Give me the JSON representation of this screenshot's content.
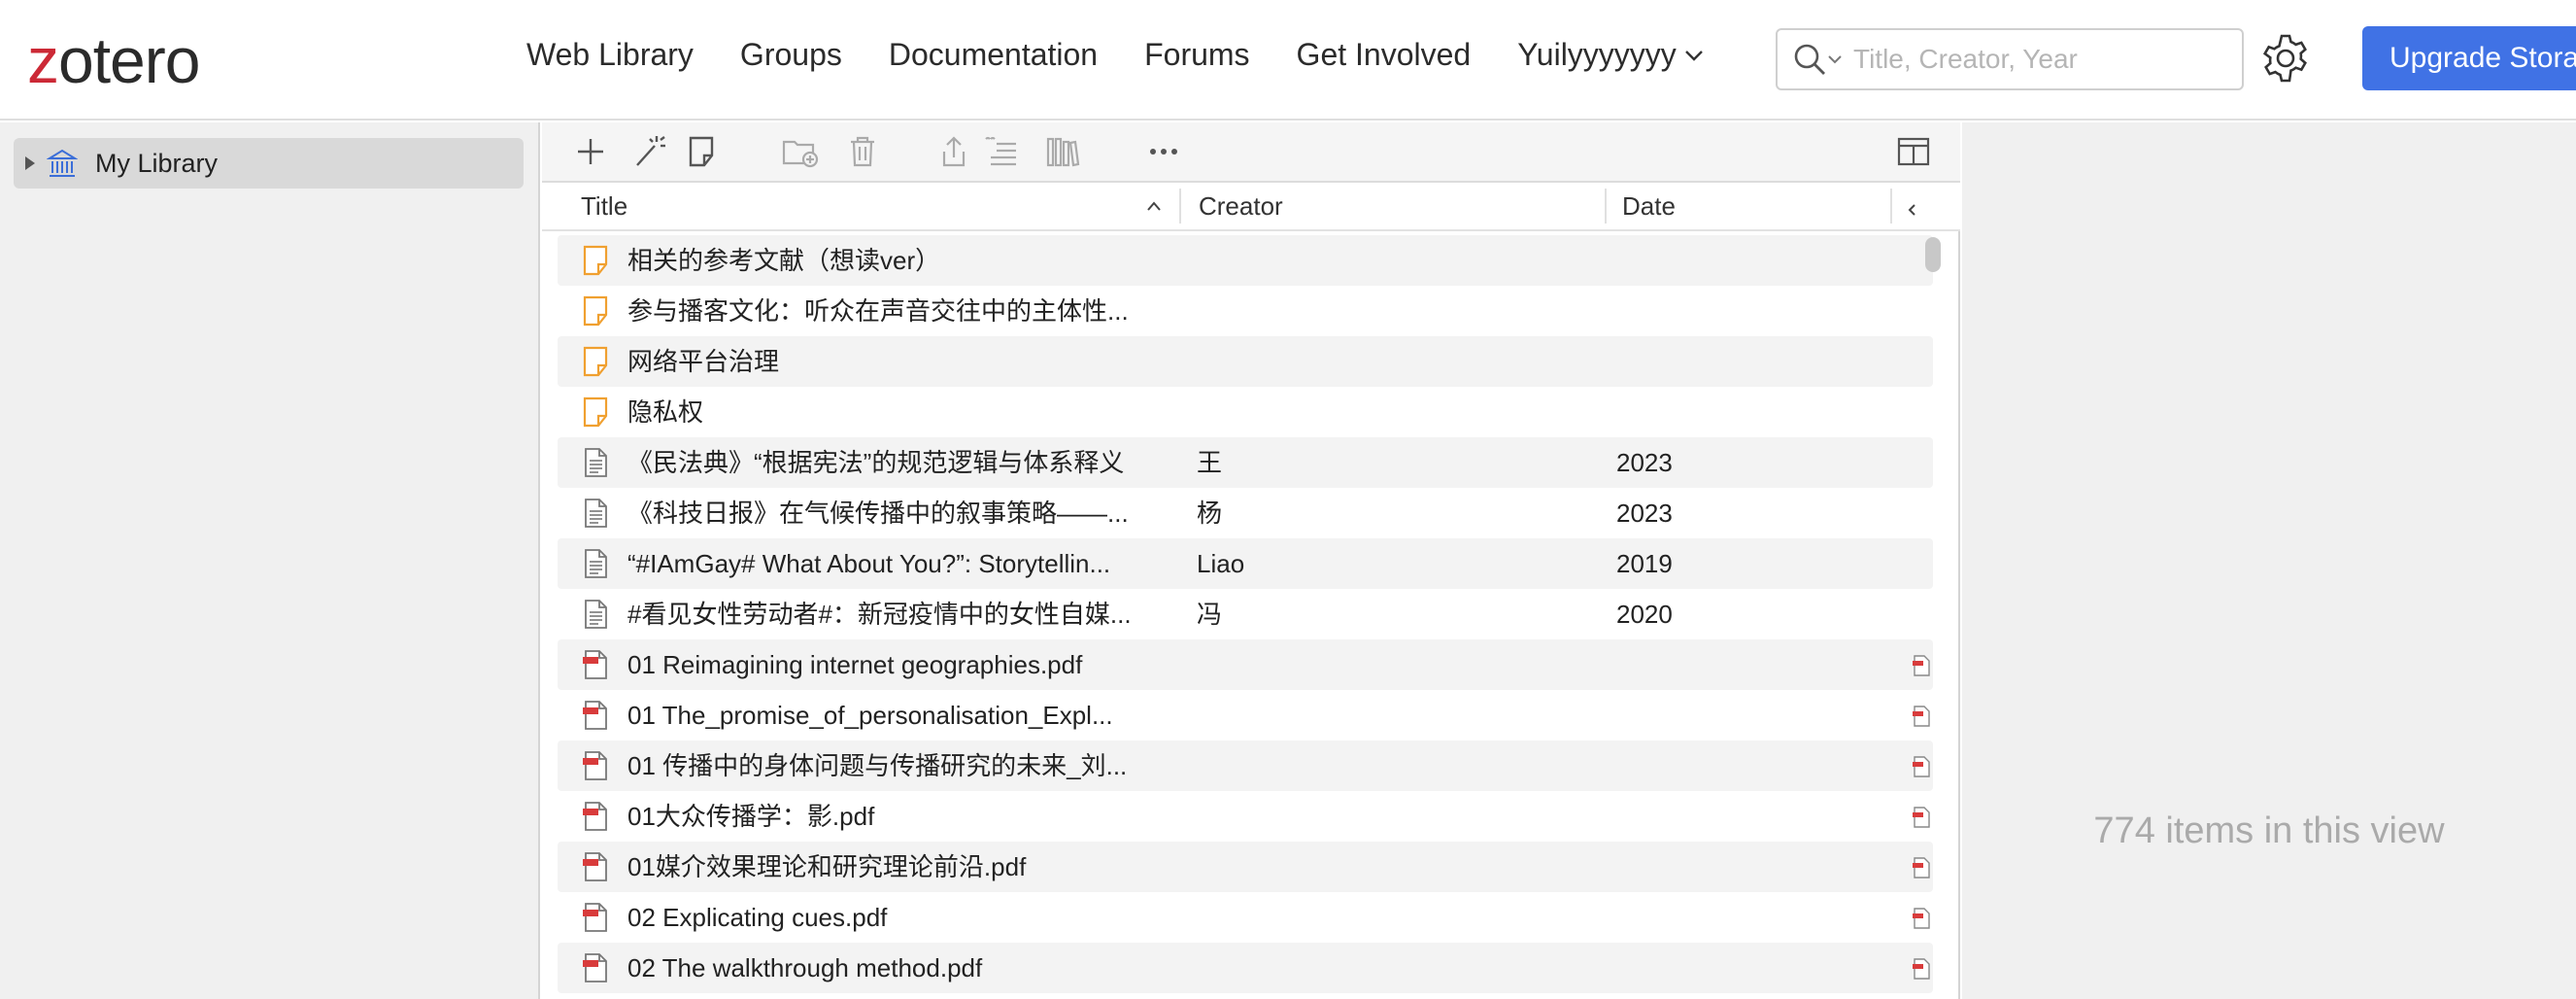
{
  "header": {
    "logo_first": "z",
    "logo_rest": "otero",
    "nav": [
      "Web Library",
      "Groups",
      "Documentation",
      "Forums",
      "Get Involved"
    ],
    "user": "Yuilyyyyyyy",
    "search_placeholder": "Title, Creator, Year",
    "upgrade_label": "Upgrade Storage"
  },
  "sidebar": {
    "library_label": "My Library"
  },
  "columns": {
    "title": "Title",
    "creator": "Creator",
    "date": "Date"
  },
  "items": [
    {
      "type": "note",
      "title": "相关的参考文献（想读ver）",
      "creator": "",
      "date": "",
      "attachment": false
    },
    {
      "type": "note",
      "title": "参与播客文化：听众在声音交往中的主体性...",
      "creator": "",
      "date": "",
      "attachment": false
    },
    {
      "type": "note",
      "title": "网络平台治理",
      "creator": "",
      "date": "",
      "attachment": false
    },
    {
      "type": "note",
      "title": "隐私权",
      "creator": "",
      "date": "",
      "attachment": false
    },
    {
      "type": "doc",
      "title": "《民法典》“根据宪法”的规范逻辑与体系释义",
      "creator": "王",
      "date": "2023",
      "attachment": false
    },
    {
      "type": "doc",
      "title": "《科技日报》在气候传播中的叙事策略——...",
      "creator": "杨",
      "date": "2023",
      "attachment": false
    },
    {
      "type": "doc",
      "title": "“#IAmGay# What About You?”: Storytellin...",
      "creator": "Liao",
      "date": "2019",
      "attachment": false
    },
    {
      "type": "doc",
      "title": "#看见女性劳动者#：新冠疫情中的女性自媒...",
      "creator": "冯",
      "date": "2020",
      "attachment": false
    },
    {
      "type": "pdf",
      "title": "01 Reimagining internet geographies.pdf",
      "creator": "",
      "date": "",
      "attachment": true
    },
    {
      "type": "pdf",
      "title": "01 The_promise_of_personalisation_Expl...",
      "creator": "",
      "date": "",
      "attachment": true
    },
    {
      "type": "pdf",
      "title": "01 传播中的身体问题与传播研究的未来_刘...",
      "creator": "",
      "date": "",
      "attachment": true
    },
    {
      "type": "pdf",
      "title": "01大众传播学：影.pdf",
      "creator": "",
      "date": "",
      "attachment": true
    },
    {
      "type": "pdf",
      "title": "01媒介效果理论和研究理论前沿.pdf",
      "creator": "",
      "date": "",
      "attachment": true
    },
    {
      "type": "pdf",
      "title": "02 Explicating cues.pdf",
      "creator": "",
      "date": "",
      "attachment": true
    },
    {
      "type": "pdf",
      "title": "02 The walkthrough method.pdf",
      "creator": "",
      "date": "",
      "attachment": true
    }
  ],
  "status": {
    "count_text": "774 items in this view"
  },
  "colors": {
    "accent": "#4072e5",
    "logo_red": "#cc2936",
    "note_orange": "#f0a030",
    "pdf_red": "#d83b3b"
  }
}
